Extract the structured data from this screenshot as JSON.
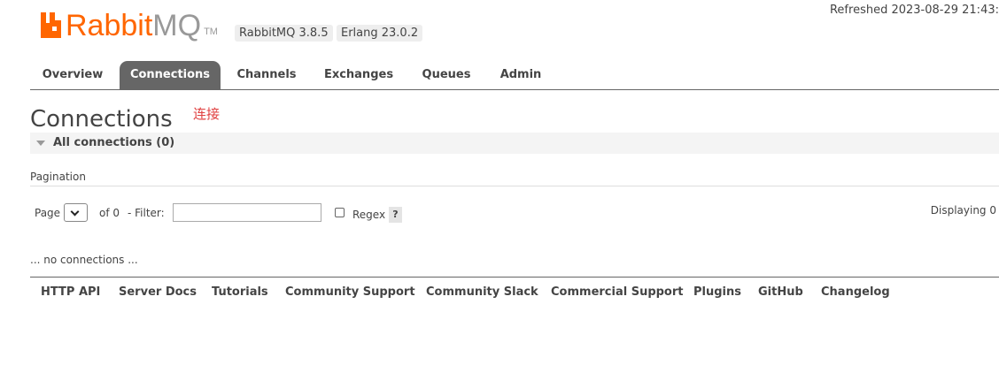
{
  "header": {
    "logo_text_primary": "Rabbit",
    "logo_text_secondary": "MQ",
    "logo_tm": "TM",
    "versions": [
      "RabbitMQ 3.8.5",
      "Erlang 23.0.2"
    ],
    "refreshed": "Refreshed 2023-08-29 21:43:",
    "brand_color": "#ff6600"
  },
  "tabs": [
    {
      "label": "Overview",
      "active": false
    },
    {
      "label": "Connections",
      "active": true
    },
    {
      "label": "Channels",
      "active": false
    },
    {
      "label": "Exchanges",
      "active": false
    },
    {
      "label": "Queues",
      "active": false
    },
    {
      "label": "Admin",
      "active": false
    }
  ],
  "main": {
    "title": "Connections",
    "annotation": "连接",
    "section_label": "All connections (0)"
  },
  "pagination": {
    "title": "Pagination",
    "page_label": "Page",
    "page_value": "",
    "of_text": "of 0",
    "filter_label": "- Filter:",
    "filter_value": "",
    "regex_label": "Regex",
    "regex_checked": false,
    "help": "?",
    "displaying": "Displaying 0"
  },
  "empty_message": "... no connections ...",
  "footer": {
    "links": [
      "HTTP API",
      "Server Docs",
      "Tutorials",
      "Community Support",
      "Community Slack",
      "Commercial Support",
      "Plugins",
      "GitHub",
      "Changelog"
    ]
  }
}
